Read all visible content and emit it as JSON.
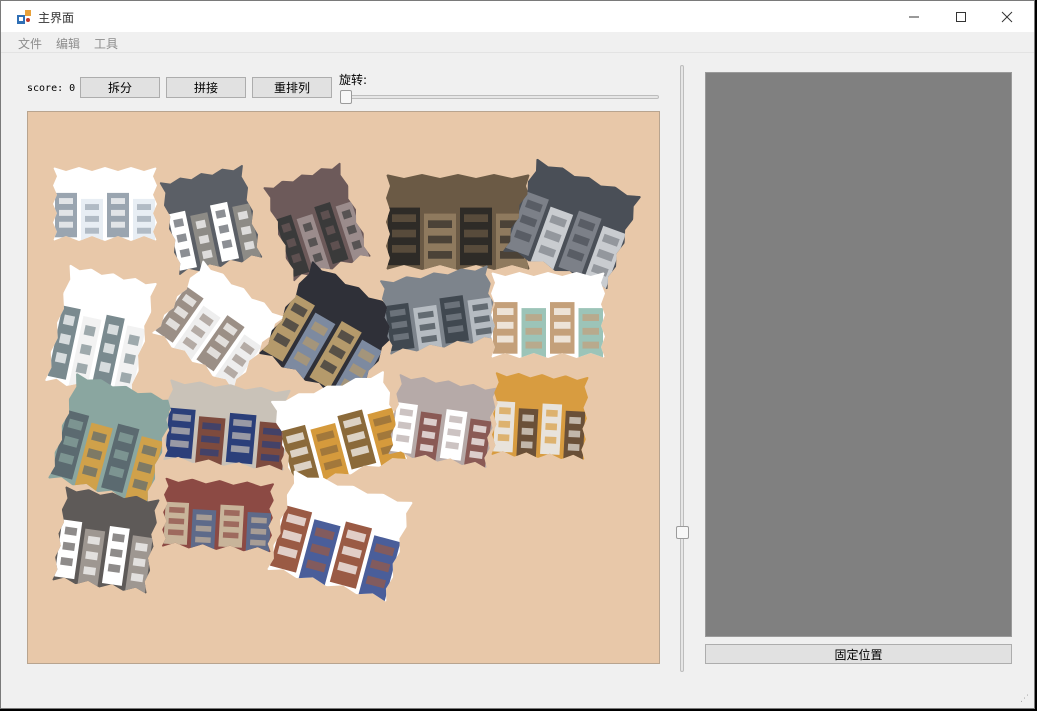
{
  "window": {
    "title": "主界面",
    "controls": {
      "minimize": "—",
      "maximize": "☐",
      "close": "✕"
    }
  },
  "menu": [
    "文件",
    "编辑",
    "工具"
  ],
  "toolbar": {
    "score_text": "score: 0",
    "split_label": "拆分",
    "stitch_label": "拼接",
    "rearrange_label": "重排列",
    "rotate_label": "旋转:",
    "rotate_value_fraction": 0
  },
  "canvas": {
    "background_color": "#e8c8a9",
    "pieces": [
      {
        "name": "piece-sky-1",
        "palette": [
          "#ffffff",
          "#e8eef4",
          "#9aa5b0"
        ]
      },
      {
        "name": "piece-building-dark-1",
        "palette": [
          "#5b5f66",
          "#8d8b86",
          "#ffffff"
        ]
      },
      {
        "name": "piece-street-1",
        "palette": [
          "#6d5a5a",
          "#9b8c8c",
          "#3a3a3a"
        ]
      },
      {
        "name": "piece-building-brick",
        "palette": [
          "#6b5a45",
          "#8f7a5e",
          "#2e2b27"
        ]
      },
      {
        "name": "piece-building-dark-2",
        "palette": [
          "#4a4f57",
          "#c9ccd0",
          "#7c8088"
        ]
      },
      {
        "name": "piece-sky-2",
        "palette": [
          "#ffffff",
          "#f2f2f2",
          "#7a8a8f"
        ]
      },
      {
        "name": "piece-sky-3",
        "palette": [
          "#ffffff",
          "#eeeeee",
          "#9b8f86"
        ]
      },
      {
        "name": "piece-tower-dark",
        "palette": [
          "#2f3038",
          "#7d8aa0",
          "#b59a6b"
        ]
      },
      {
        "name": "piece-building-grey",
        "palette": [
          "#7d848c",
          "#b6bcc2",
          "#404850"
        ]
      },
      {
        "name": "piece-facade-green",
        "palette": [
          "#ffffff",
          "#9cc4b8",
          "#c4a07a"
        ]
      },
      {
        "name": "piece-facade-yellow-1",
        "palette": [
          "#8aa6a0",
          "#d0a14a",
          "#5b6a70"
        ]
      },
      {
        "name": "piece-market-stall",
        "palette": [
          "#c9c2b8",
          "#7e4b3e",
          "#2b3f7a"
        ]
      },
      {
        "name": "piece-facade-yellow-2",
        "palette": [
          "#ffffff",
          "#d59a3c",
          "#8b6a3a"
        ]
      },
      {
        "name": "piece-people-square",
        "palette": [
          "#b6aaa8",
          "#8a5a55",
          "#ffffff"
        ]
      },
      {
        "name": "piece-facade-yellow-3",
        "palette": [
          "#d89c40",
          "#6a5038",
          "#e8e3dc"
        ]
      },
      {
        "name": "piece-arches",
        "palette": [
          "#5e5a58",
          "#9e9791",
          "#ffffff"
        ]
      },
      {
        "name": "piece-facade-red",
        "palette": [
          "#8c4a44",
          "#5e6a8a",
          "#c8b49a"
        ]
      },
      {
        "name": "piece-facade-blue",
        "palette": [
          "#ffffff",
          "#4a5e9a",
          "#9a5a44"
        ]
      }
    ]
  },
  "preview": {
    "background_color": "#808080"
  },
  "fix_button_label": "固定位置"
}
